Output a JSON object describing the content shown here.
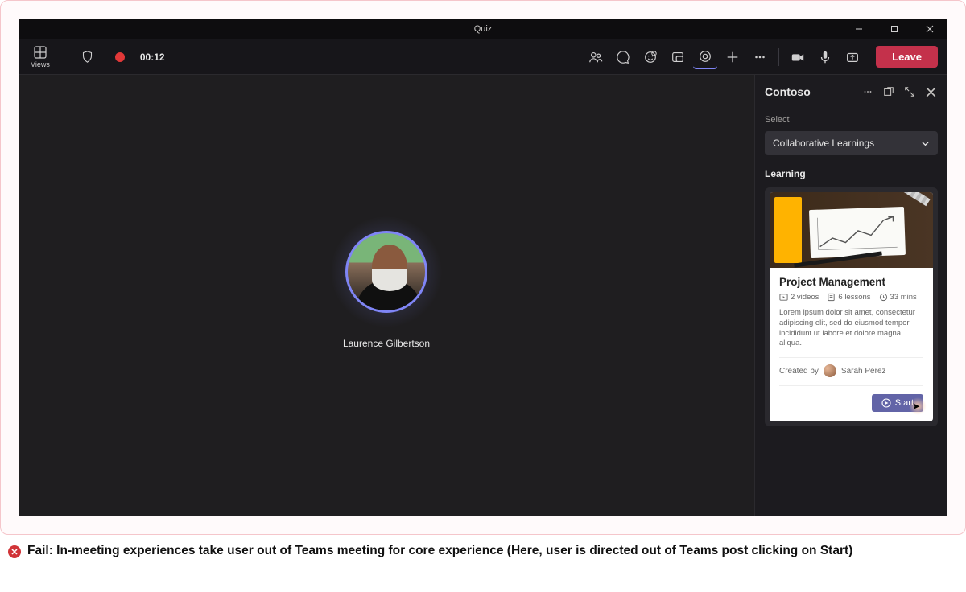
{
  "window": {
    "title": "Quiz"
  },
  "toolbar": {
    "views_label": "Views",
    "timer": "00:12",
    "leave_label": "Leave"
  },
  "participant": {
    "name": "Laurence Gilbertson"
  },
  "sidepanel": {
    "title": "Contoso",
    "select_label": "Select",
    "dropdown_value": "Collaborative Learnings",
    "section_title": "Learning",
    "card": {
      "title": "Project Management",
      "videos": "2 videos",
      "lessons": "6 lessons",
      "duration": "33 mins",
      "description": "Lorem ipsum dolor sit amet, consectetur adipiscing elit, sed do eiusmod tempor incididunt ut labore et dolore magna aliqua.",
      "created_by_label": "Created by",
      "author": "Sarah Perez",
      "start_label": "Start"
    }
  },
  "caption": "Fail: In-meeting experiences take user out of Teams meeting for core experience (Here, user is directed out of Teams post clicking on Start)"
}
